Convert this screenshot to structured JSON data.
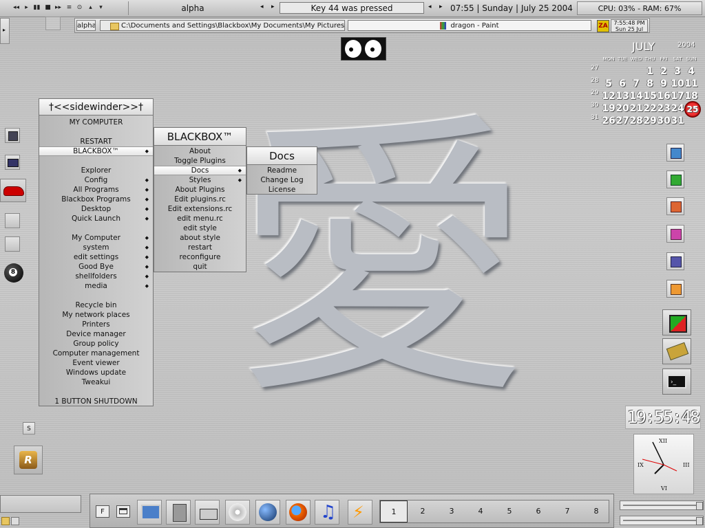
{
  "topbar": {
    "media_buttons": [
      "◂◂",
      "▸",
      "▮▮",
      "■",
      "▸▸",
      "≡",
      "⊙",
      "▴",
      "▾"
    ],
    "workspace_name": "alpha",
    "ws_prev": "◂",
    "ws_next": "▸",
    "key_message": "Key 44 was pressed",
    "task_prev": "◂",
    "task_next": "▸",
    "datetime": "07:55 | Sunday |  July 25 2004",
    "cpu_ram": "CPU: 03% - RAM: 67%"
  },
  "taskbar2": {
    "workspace": "alpha",
    "folder_path": "C:\\Documents and Settings\\Blackbox\\My Documents\\My Pictures\\upload",
    "active_window": "dragon - Paint",
    "za_badge": "ZA",
    "time": "7:55:48 PM",
    "date": "Sun 25 Jul"
  },
  "main_menu": {
    "title": "†<<sidewinder>>†",
    "items": [
      {
        "label": "MY COMPUTER",
        "sub": false
      },
      {
        "label": "",
        "sub": false
      },
      {
        "label": "RESTART",
        "sub": false
      },
      {
        "label": "BLACKBOX™",
        "sub": true,
        "hl": true
      },
      {
        "label": "",
        "sub": false
      },
      {
        "label": "Explorer",
        "sub": false
      },
      {
        "label": "Config",
        "sub": true
      },
      {
        "label": "All Programs",
        "sub": true
      },
      {
        "label": "Blackbox Programs",
        "sub": true
      },
      {
        "label": "Desktop",
        "sub": true
      },
      {
        "label": "Quick Launch",
        "sub": true
      },
      {
        "label": "",
        "sub": false
      },
      {
        "label": "My Computer",
        "sub": true
      },
      {
        "label": "system",
        "sub": true
      },
      {
        "label": "edit settings",
        "sub": true
      },
      {
        "label": "Good Bye",
        "sub": true
      },
      {
        "label": "shellfolders",
        "sub": true
      },
      {
        "label": "media",
        "sub": true
      },
      {
        "label": "",
        "sub": false
      },
      {
        "label": "Recycle bin",
        "sub": false
      },
      {
        "label": "My network places",
        "sub": false
      },
      {
        "label": "Printers",
        "sub": false
      },
      {
        "label": "Device manager",
        "sub": false
      },
      {
        "label": "Group policy",
        "sub": false
      },
      {
        "label": "Computer management",
        "sub": false
      },
      {
        "label": "Event viewer",
        "sub": false
      },
      {
        "label": "Windows update",
        "sub": false
      },
      {
        "label": "Tweakui",
        "sub": false
      },
      {
        "label": "",
        "sub": false
      },
      {
        "label": "1 BUTTON SHUTDOWN",
        "sub": false
      }
    ]
  },
  "blackbox_menu": {
    "title": "BLACKBOX™",
    "items": [
      {
        "label": "About",
        "sub": false
      },
      {
        "label": "Toggle Plugins",
        "sub": false
      },
      {
        "label": "Docs",
        "sub": true,
        "hl": true
      },
      {
        "label": "Styles",
        "sub": true
      },
      {
        "label": "About Plugins",
        "sub": false
      },
      {
        "label": "Edit plugins.rc",
        "sub": false
      },
      {
        "label": "Edit extensions.rc",
        "sub": false
      },
      {
        "label": "edit menu.rc",
        "sub": false
      },
      {
        "label": "edit style",
        "sub": false
      },
      {
        "label": "about style",
        "sub": false
      },
      {
        "label": "restart",
        "sub": false
      },
      {
        "label": "reconfigure",
        "sub": false
      },
      {
        "label": "quit",
        "sub": false
      }
    ]
  },
  "docs_menu": {
    "title": "Docs",
    "items": [
      {
        "label": "Readme",
        "sub": false
      },
      {
        "label": "Change Log",
        "sub": false
      },
      {
        "label": "License",
        "sub": false
      }
    ]
  },
  "calendar": {
    "month": "JULY",
    "year": "2004",
    "day_names": [
      "MON",
      "TUE",
      "WED",
      "THU",
      "FRI",
      "SAT",
      "SUN"
    ],
    "weeks": [
      {
        "wk": "27",
        "days": [
          "",
          "",
          "",
          "1",
          "2",
          "3",
          "4"
        ]
      },
      {
        "wk": "28",
        "days": [
          "5",
          "6",
          "7",
          "8",
          "9",
          "10",
          "11"
        ]
      },
      {
        "wk": "29",
        "days": [
          "12",
          "13",
          "14",
          "15",
          "16",
          "17",
          "18"
        ]
      },
      {
        "wk": "30",
        "days": [
          "19",
          "20",
          "21",
          "22",
          "23",
          "24",
          "25"
        ]
      },
      {
        "wk": "31",
        "days": [
          "26",
          "27",
          "28",
          "29",
          "30",
          "31",
          ""
        ]
      }
    ],
    "today": "25"
  },
  "digital_clock": "19:55:48",
  "analog_clock": {
    "numerals": [
      "XII",
      "III",
      "VI",
      "IX"
    ]
  },
  "workspaces": [
    "1",
    "2",
    "3",
    "4",
    "5",
    "6",
    "7",
    "8"
  ],
  "dock": {
    "tray_f": "F"
  },
  "left_panel": {
    "small_button": "S",
    "eight_ball": "8"
  },
  "kanji": "愛"
}
